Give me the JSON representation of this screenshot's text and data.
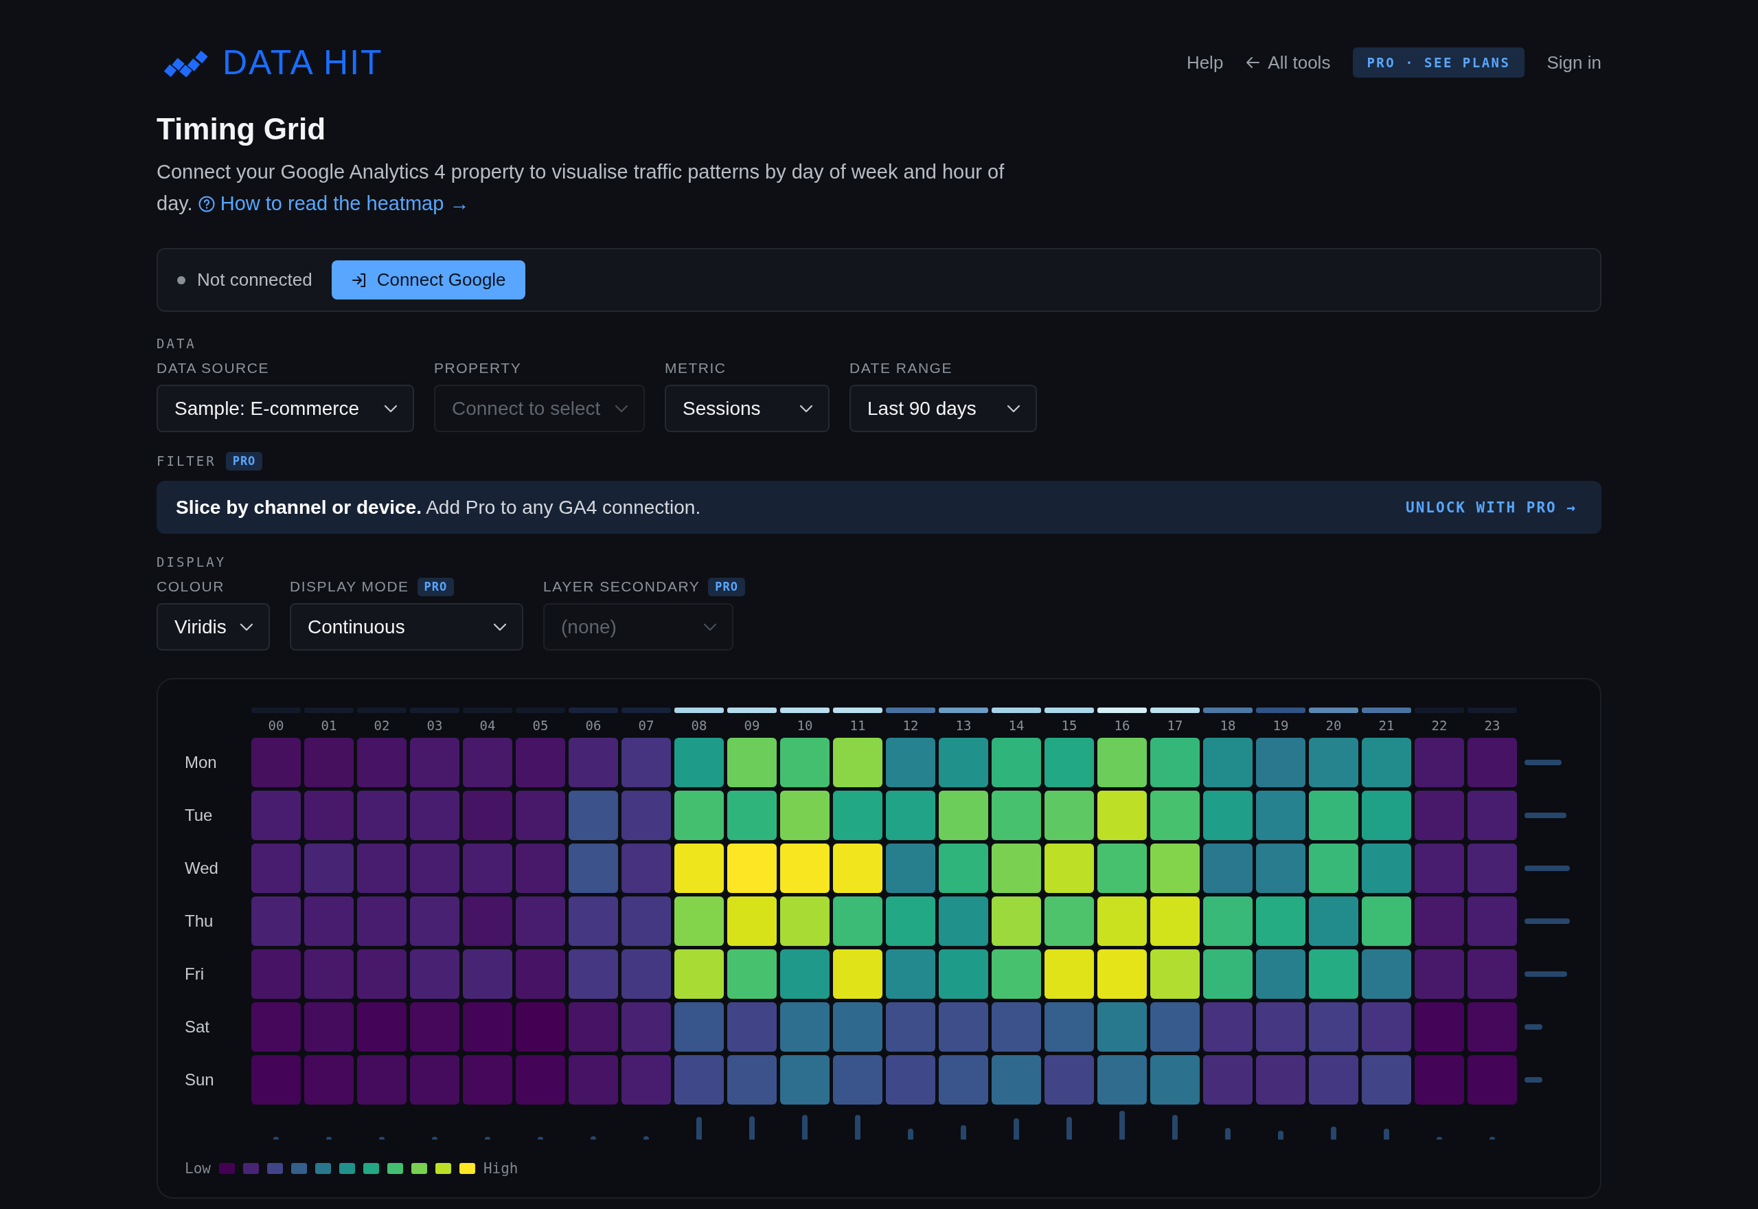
{
  "header": {
    "logo": "DATA HIT",
    "nav": [
      {
        "kind": "link",
        "label": "Help"
      },
      {
        "kind": "back",
        "label": "All tools"
      },
      {
        "kind": "badge",
        "label": "PRO · SEE PLANS"
      },
      {
        "kind": "link",
        "label": "Sign in"
      }
    ]
  },
  "page": {
    "title": "Timing Grid",
    "description": "Connect your Google Analytics 4 property to visualise traffic patterns by day of week and hour of day.",
    "help_link": "How to read the heatmap →"
  },
  "connection": {
    "connected": false,
    "status": "Not connected",
    "button": "Connect Google"
  },
  "data_section": {
    "label": "DATA",
    "fields": [
      {
        "label": "DATA SOURCE",
        "value": "Sample: E-commerce",
        "disabled": false
      },
      {
        "label": "PROPERTY",
        "value": "Connect to select",
        "disabled": true
      },
      {
        "label": "METRIC",
        "value": "Sessions",
        "disabled": false
      },
      {
        "label": "DATE RANGE",
        "value": "Last 90 days",
        "disabled": false
      }
    ]
  },
  "filter_section": {
    "label": "FILTER",
    "badge": "PRO",
    "banner": {
      "text": "**Slice by channel or device.** Add Pro to any GA4 connection.",
      "action": "UNLOCK WITH PRO →"
    }
  },
  "display_section": {
    "label": "DISPLAY",
    "fields": [
      {
        "label": "COLOUR",
        "value": "Viridis",
        "disabled": false
      },
      {
        "label": "DISPLAY MODE",
        "badge": "PRO",
        "value": "Continuous",
        "disabled": false
      },
      {
        "label": "LAYER SECONDARY",
        "badge": "PRO",
        "value": "(none)",
        "disabled": true
      }
    ]
  },
  "heatmap": {
    "hours": [
      "00",
      "01",
      "02",
      "03",
      "04",
      "05",
      "06",
      "07",
      "08",
      "09",
      "10",
      "11",
      "12",
      "13",
      "14",
      "15",
      "16",
      "17",
      "18",
      "19",
      "20",
      "21",
      "22",
      "23"
    ],
    "rows": [
      {
        "day": "Mon",
        "cells": [
          {
            "color": "#46105f"
          },
          {
            "color": "#46105f"
          },
          {
            "color": "#471365"
          },
          {
            "color": "#48186a"
          },
          {
            "color": "#48186a"
          },
          {
            "color": "#471365"
          },
          {
            "color": "#482475"
          },
          {
            "color": "#463480"
          },
          {
            "color": "#1e9c89"
          },
          {
            "color": "#6ccd5a"
          },
          {
            "color": "#44bf70"
          },
          {
            "color": "#8ad647"
          },
          {
            "color": "#26828e"
          },
          {
            "color": "#21918c"
          },
          {
            "color": "#2fb47c"
          },
          {
            "color": "#22a884"
          },
          {
            "color": "#6ccd5a"
          },
          {
            "color": "#35b779"
          },
          {
            "color": "#228c8d"
          },
          {
            "color": "#2a788e"
          },
          {
            "color": "#25848e"
          },
          {
            "color": "#228c8d"
          },
          {
            "color": "#48186a"
          },
          {
            "color": "#471365"
          }
        ]
      },
      {
        "day": "Tue",
        "cells": [
          {
            "color": "#481d6f"
          },
          {
            "color": "#48186a"
          },
          {
            "color": "#481d6f"
          },
          {
            "color": "#481d6f"
          },
          {
            "color": "#471365"
          },
          {
            "color": "#48186a"
          },
          {
            "color": "#3b528b"
          },
          {
            "color": "#453781"
          },
          {
            "color": "#44bf70"
          },
          {
            "color": "#2fb47c"
          },
          {
            "color": "#7ad151"
          },
          {
            "color": "#22a884"
          },
          {
            "color": "#20a386"
          },
          {
            "color": "#6ccd5a"
          },
          {
            "color": "#48c16e"
          },
          {
            "color": "#5ec962"
          },
          {
            "color": "#bddf26"
          },
          {
            "color": "#48c16e"
          },
          {
            "color": "#1f9e89"
          },
          {
            "color": "#26828e"
          },
          {
            "color": "#35b779"
          },
          {
            "color": "#1fa187"
          },
          {
            "color": "#48186a"
          },
          {
            "color": "#481d6f"
          }
        ]
      },
      {
        "day": "Wed",
        "cells": [
          {
            "color": "#481d6f"
          },
          {
            "color": "#482475"
          },
          {
            "color": "#481d6f"
          },
          {
            "color": "#481d6f"
          },
          {
            "color": "#481d6f"
          },
          {
            "color": "#48186a"
          },
          {
            "color": "#3b528b"
          },
          {
            "color": "#46327e"
          },
          {
            "color": "#efe51c"
          },
          {
            "color": "#fde725"
          },
          {
            "color": "#f8e621"
          },
          {
            "color": "#f1e51d"
          },
          {
            "color": "#277f8e"
          },
          {
            "color": "#2fb47c"
          },
          {
            "color": "#7ad151"
          },
          {
            "color": "#bddf26"
          },
          {
            "color": "#48c16e"
          },
          {
            "color": "#84d44b"
          },
          {
            "color": "#2a788e"
          },
          {
            "color": "#287c8e"
          },
          {
            "color": "#38b977"
          },
          {
            "color": "#21918c"
          },
          {
            "color": "#481d6f"
          },
          {
            "color": "#482173"
          }
        ]
      },
      {
        "day": "Thu",
        "cells": [
          {
            "color": "#482173"
          },
          {
            "color": "#481d6f"
          },
          {
            "color": "#481d6f"
          },
          {
            "color": "#482173"
          },
          {
            "color": "#471365"
          },
          {
            "color": "#481d6f"
          },
          {
            "color": "#453781"
          },
          {
            "color": "#453882"
          },
          {
            "color": "#84d44b"
          },
          {
            "color": "#d8e219"
          },
          {
            "color": "#a8db34"
          },
          {
            "color": "#3bbb75"
          },
          {
            "color": "#22a884"
          },
          {
            "color": "#21918c"
          },
          {
            "color": "#9bd93c"
          },
          {
            "color": "#4ec36b"
          },
          {
            "color": "#cae11f"
          },
          {
            "color": "#d2e21b"
          },
          {
            "color": "#38b977"
          },
          {
            "color": "#25ac82"
          },
          {
            "color": "#228c8d"
          },
          {
            "color": "#3dbc74"
          },
          {
            "color": "#48186a"
          },
          {
            "color": "#481d6f"
          }
        ]
      },
      {
        "day": "Fri",
        "cells": [
          {
            "color": "#471365"
          },
          {
            "color": "#48186a"
          },
          {
            "color": "#48186a"
          },
          {
            "color": "#482173"
          },
          {
            "color": "#482475"
          },
          {
            "color": "#471365"
          },
          {
            "color": "#453781"
          },
          {
            "color": "#453882"
          },
          {
            "color": "#a8db34"
          },
          {
            "color": "#48c16e"
          },
          {
            "color": "#1f998a"
          },
          {
            "color": "#dfe318"
          },
          {
            "color": "#23898e"
          },
          {
            "color": "#1e9c89"
          },
          {
            "color": "#48c16e"
          },
          {
            "color": "#dfe318"
          },
          {
            "color": "#e5e419"
          },
          {
            "color": "#b0dd2f"
          },
          {
            "color": "#35b779"
          },
          {
            "color": "#277f8e"
          },
          {
            "color": "#25ac82"
          },
          {
            "color": "#2a788e"
          },
          {
            "color": "#48186a"
          },
          {
            "color": "#48186a"
          }
        ]
      },
      {
        "day": "Sat",
        "cells": [
          {
            "color": "#45085a"
          },
          {
            "color": "#450b5c"
          },
          {
            "color": "#440457"
          },
          {
            "color": "#45085a"
          },
          {
            "color": "#440457"
          },
          {
            "color": "#440154"
          },
          {
            "color": "#471365"
          },
          {
            "color": "#482173"
          },
          {
            "color": "#39568c"
          },
          {
            "color": "#414487"
          },
          {
            "color": "#2e6e8e"
          },
          {
            "color": "#30698e"
          },
          {
            "color": "#3d4e8a"
          },
          {
            "color": "#3d4e8a"
          },
          {
            "color": "#3b528b"
          },
          {
            "color": "#355f8d"
          },
          {
            "color": "#29798e"
          },
          {
            "color": "#375b8d"
          },
          {
            "color": "#46327e"
          },
          {
            "color": "#453781"
          },
          {
            "color": "#433e85"
          },
          {
            "color": "#463480"
          },
          {
            "color": "#440457"
          },
          {
            "color": "#45085a"
          }
        ]
      },
      {
        "day": "Sun",
        "cells": [
          {
            "color": "#440457"
          },
          {
            "color": "#45085a"
          },
          {
            "color": "#450b5c"
          },
          {
            "color": "#450b5c"
          },
          {
            "color": "#45085a"
          },
          {
            "color": "#440457"
          },
          {
            "color": "#471365"
          },
          {
            "color": "#481d6f"
          },
          {
            "color": "#3f4889"
          },
          {
            "color": "#3b528b"
          },
          {
            "color": "#2e6e8e"
          },
          {
            "color": "#3a548c"
          },
          {
            "color": "#3f4889"
          },
          {
            "color": "#3a548c"
          },
          {
            "color": "#30698e"
          },
          {
            "color": "#414487"
          },
          {
            "color": "#2f6c8e"
          },
          {
            "color": "#2c728e"
          },
          {
            "color": "#472c7a"
          },
          {
            "color": "#472c7a"
          },
          {
            "color": "#453882"
          },
          {
            "color": "#414487"
          },
          {
            "color": "#440457"
          },
          {
            "color": "#440457"
          }
        ]
      }
    ],
    "legend": {
      "low": "Low",
      "high": "High"
    }
  }
}
